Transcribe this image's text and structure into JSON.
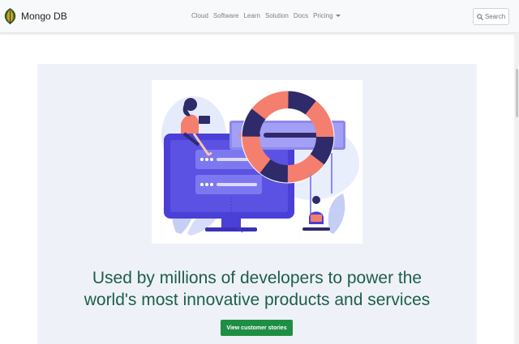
{
  "header": {
    "brand_name": "Mongo DB",
    "logo_icon": "mongodb-leaf-icon",
    "nav_items": [
      {
        "label": "Cloud"
      },
      {
        "label": "Software"
      },
      {
        "label": "Learn"
      },
      {
        "label": "Solution"
      },
      {
        "label": "Docs"
      },
      {
        "label": "Pricing",
        "has_dropdown": true
      }
    ],
    "search": {
      "label": "Search",
      "icon": "search-icon"
    }
  },
  "hero": {
    "illustration": "customer-support-illustration",
    "headline_line1": "Used by millions of developers to power the",
    "headline_line2": "world's most innovative products and services",
    "cta_label": "View customer stories"
  },
  "colors": {
    "navbar_bg": "#f8f9fa",
    "hero_bg": "#eef2f8",
    "headline": "#1e5e49",
    "cta_bg": "#1e8e43",
    "illustration_primary": "#4a3fd6",
    "illustration_accent": "#f47f6e"
  }
}
